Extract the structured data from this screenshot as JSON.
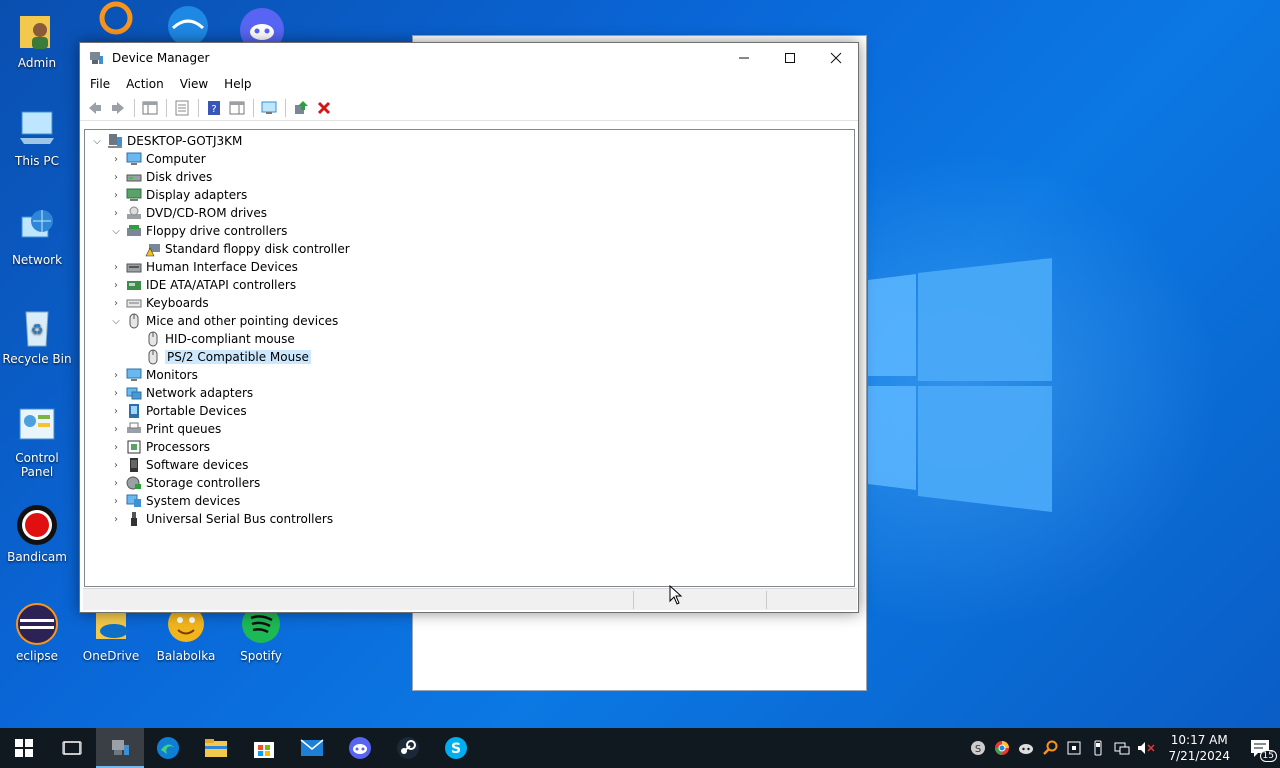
{
  "desktop": {
    "icons": [
      {
        "label": "Admin"
      },
      {
        "label": "This PC"
      },
      {
        "label": "Network"
      },
      {
        "label": "Recycle Bin"
      },
      {
        "label": "Control Panel"
      },
      {
        "label": "Bandicam"
      },
      {
        "label": "eclipse"
      },
      {
        "label": "OneDrive"
      },
      {
        "label": "Balabolka"
      },
      {
        "label": "Spotify"
      }
    ]
  },
  "window": {
    "title": "Device Manager",
    "menu": [
      "File",
      "Action",
      "View",
      "Help"
    ],
    "tree": {
      "root": "DESKTOP-GOTJ3KM",
      "items": [
        {
          "label": "Computer"
        },
        {
          "label": "Disk drives"
        },
        {
          "label": "Display adapters"
        },
        {
          "label": "DVD/CD-ROM drives"
        },
        {
          "label": "Floppy drive controllers"
        },
        {
          "label": "Standard floppy disk controller"
        },
        {
          "label": "Human Interface Devices"
        },
        {
          "label": "IDE ATA/ATAPI controllers"
        },
        {
          "label": "Keyboards"
        },
        {
          "label": "Mice and other pointing devices"
        },
        {
          "label": "HID-compliant mouse"
        },
        {
          "label": "PS/2 Compatible Mouse"
        },
        {
          "label": "Monitors"
        },
        {
          "label": "Network adapters"
        },
        {
          "label": "Portable Devices"
        },
        {
          "label": "Print queues"
        },
        {
          "label": "Processors"
        },
        {
          "label": "Software devices"
        },
        {
          "label": "Storage controllers"
        },
        {
          "label": "System devices"
        },
        {
          "label": "Universal Serial Bus controllers"
        }
      ]
    }
  },
  "taskbar": {
    "time": "10:17 AM",
    "date": "7/21/2024",
    "notification_count": "15"
  },
  "colors": {
    "selection": "#cce8ff",
    "taskbar": "#101820",
    "accent": "#76b9ed"
  }
}
